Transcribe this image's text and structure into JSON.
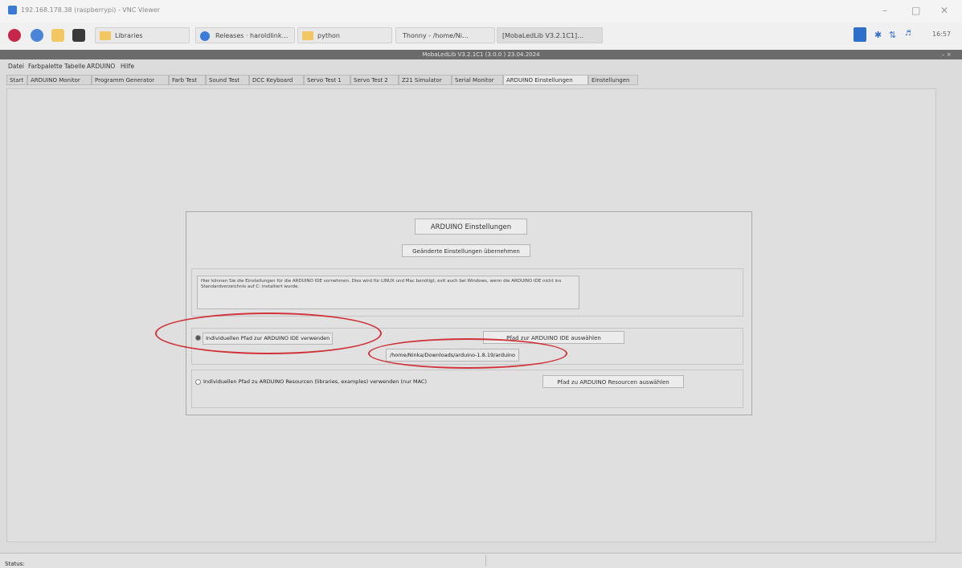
{
  "vnc": {
    "title": "192.168.178.38 (raspberrypi) - VNC Viewer",
    "icon": "vnc-viewer-icon"
  },
  "taskbar": {
    "items": [
      {
        "label": "Libraries",
        "icon": "folder-icon"
      },
      {
        "label": "Releases · haroldlink…",
        "icon": "chromium-icon"
      },
      {
        "label": "python",
        "icon": "folder-icon"
      },
      {
        "label": "Thonny - /home/Ni…",
        "icon": "thonny-icon"
      },
      {
        "label": "[MobaLedLib V3.2.1C1]…",
        "icon": "window-icon"
      }
    ],
    "clock": "16:57"
  },
  "app": {
    "header": "MobaLedLib V3.2.1C1 (3.0.0 ) 23.04.2024",
    "menu": [
      "Datei",
      "Farbpalette",
      "Tabelle",
      "ARDUINO",
      "Hilfe"
    ],
    "tabs": [
      "Start",
      "ARDUINO Monitor",
      "Programm Generator",
      "Farb Test",
      "Sound Test",
      "DCC Keyboard",
      "Servo Test 1",
      "Servo Test 2",
      "Z21 Simulator",
      "Serial Monitor",
      "ARDUINO Einstellungen",
      "Einstellungen"
    ],
    "selected_tab": "ARDUINO Einstellungen"
  },
  "panel": {
    "title": "ARDUINO Einstellungen",
    "apply_button": "Geänderte Einstellungen übernehmen",
    "info_text": "Hier können Sie die Einstellungen für die ARDUINO IDE vornehmen. Dies wird für LINUX und Mac benötigt, evtl auch bei Windows, wenn die ARDUINO IDE nicht ins Standardverzeichnis auf C: installiert wurde.",
    "ide_radio": "Individuellen Pfad zur ARDUINO IDE verwenden",
    "ide_select_button": "Pfad zur ARDUINO IDE auswählen",
    "ide_path": "/home/Ninka/Downloads/arduino-1.8.19/arduino",
    "resources_radio": "Individuellen Pfad zu ARDUINO Resourcen (libraries, examples) verwenden (nur MAC)",
    "resources_button": "Pfad zu ARDUINO Resourcen auswählen"
  },
  "status": {
    "label": "Status:"
  },
  "colors": {
    "highlight": "#d0343a"
  }
}
